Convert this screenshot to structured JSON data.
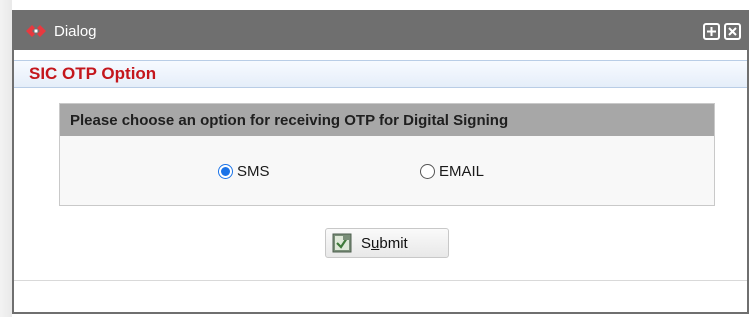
{
  "dialog": {
    "title": "Dialog",
    "logo_icon": "diamond-logo-icon",
    "title_buttons": [
      {
        "name": "maximize-icon"
      },
      {
        "name": "close-icon"
      }
    ]
  },
  "section": {
    "title": "SIC OTP Option"
  },
  "panel": {
    "header": "Please choose an option for receiving OTP for Digital Signing",
    "options": [
      {
        "label": "SMS",
        "selected": true
      },
      {
        "label": "EMAIL",
        "selected": false
      }
    ]
  },
  "submit": {
    "label_prefix": "S",
    "label_underlined": "u",
    "label_suffix": "bmit",
    "icon": "submit-icon"
  },
  "colors": {
    "titlebar": "#6f6f6f",
    "section_title": "#c4161c",
    "radio_accent": "#1a73e8",
    "panel_header": "#a7a7a7",
    "logo": "#e8393f"
  }
}
